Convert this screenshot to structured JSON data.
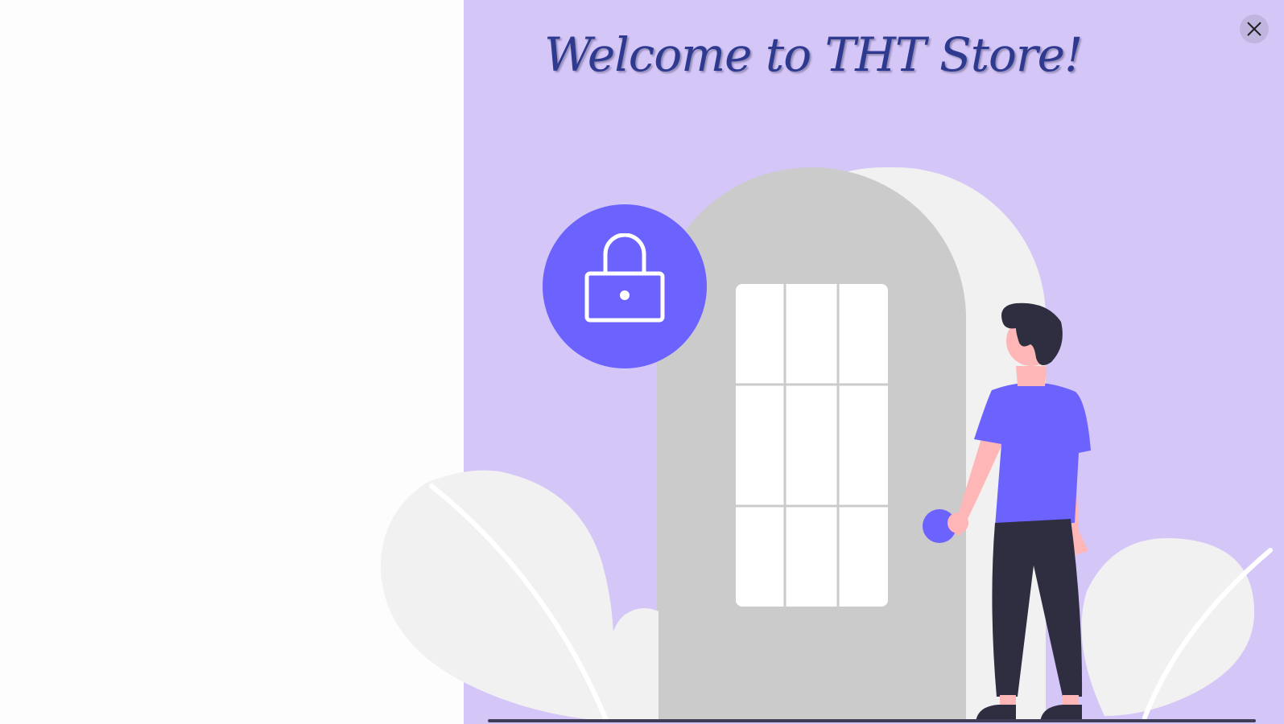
{
  "modal": {
    "title": "Welcome to THT Store!"
  },
  "icons": {
    "close": "close-icon",
    "lock": "lock-icon"
  },
  "colors": {
    "modal_background": "#d5c6f8",
    "title": "#2e3a8f",
    "accent": "#6c63ff",
    "door": "#cbcbcb",
    "foliage": "#f1f1f1",
    "dark": "#2f2e41",
    "skin": "#ffb6b6"
  }
}
